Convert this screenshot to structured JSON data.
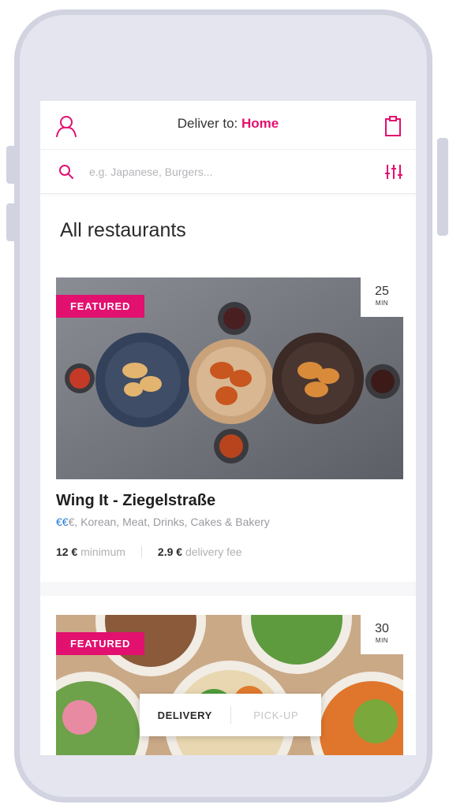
{
  "header": {
    "deliver_prefix": "Deliver to: ",
    "location": "Home",
    "icons": {
      "user": "user-icon",
      "basket": "basket-icon"
    }
  },
  "search": {
    "placeholder": "e.g. Japanese, Burgers...",
    "icons": {
      "search": "search-icon",
      "filter": "filter-icon"
    }
  },
  "section_title": "All restaurants",
  "restaurants": [
    {
      "badge": "FEATURED",
      "eta_value": "25",
      "eta_unit": "MIN",
      "name": "Wing It - Ziegelstraße",
      "price_active": "€€",
      "price_rest": "€",
      "tags": ", Korean, Meat, Drinks, Cakes & Bakery",
      "minimum_value": "12 €",
      "minimum_label": " minimum",
      "fee_value": "2.9 €",
      "fee_label": " delivery fee"
    },
    {
      "badge": "FEATURED",
      "eta_value": "30",
      "eta_unit": "MIN"
    }
  ],
  "mode_toggle": {
    "delivery": "DELIVERY",
    "pickup": "PICK-UP",
    "selected": "DELIVERY"
  },
  "colors": {
    "brand": "#e2106f",
    "price_active": "#1f7bd6",
    "phone_frame": "#d1d3e0",
    "phone_body": "#e4e5ee"
  }
}
